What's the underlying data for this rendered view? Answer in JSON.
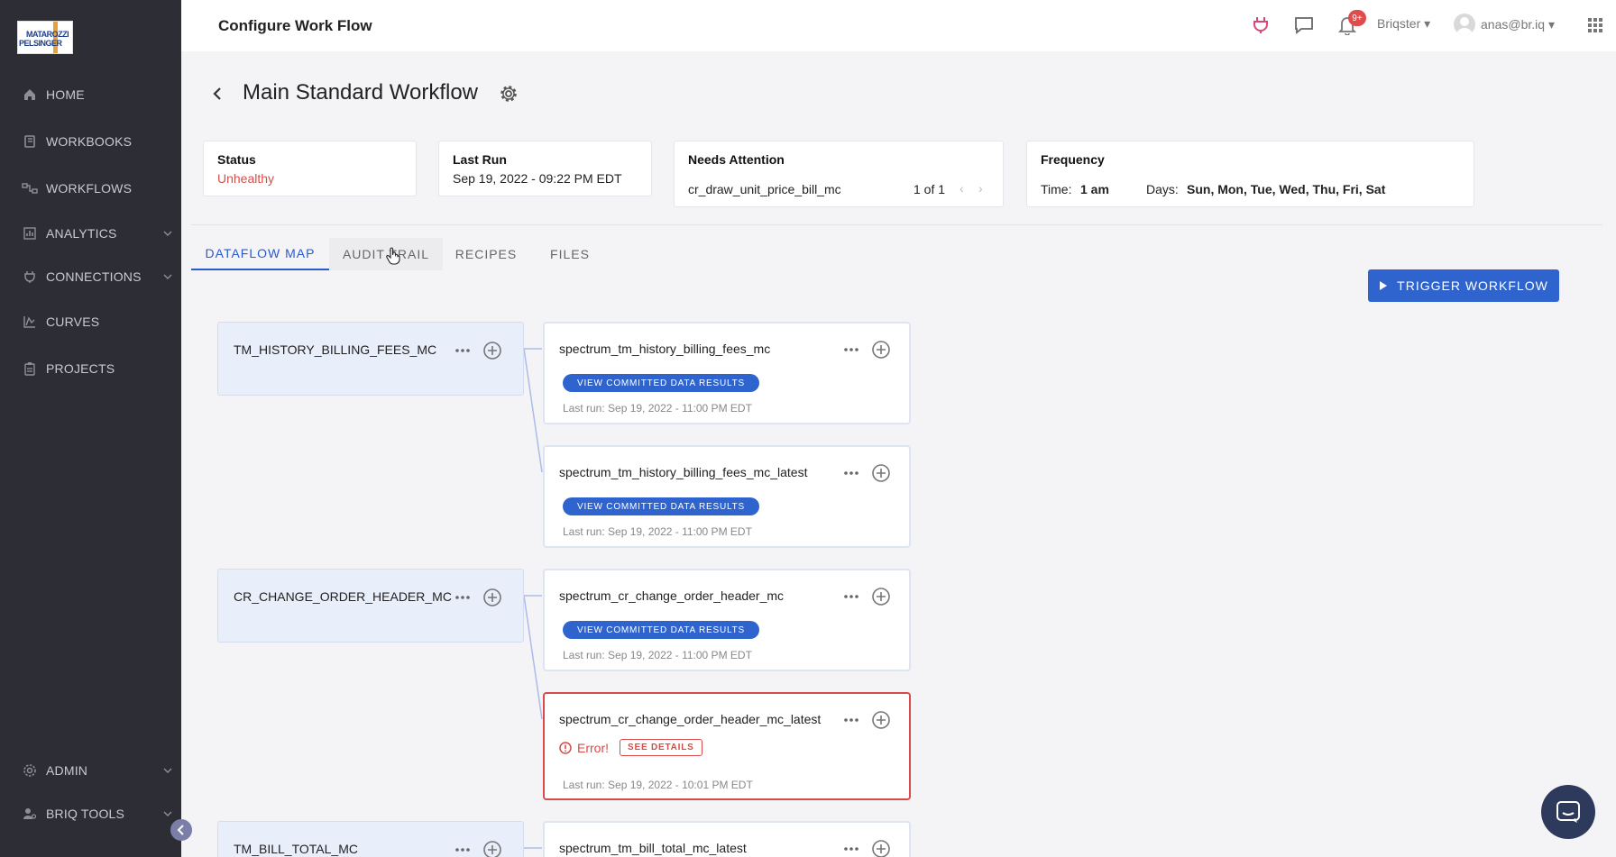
{
  "sidebar": {
    "logo_line1": "MATAROZZI",
    "logo_line2": "PELSINGER",
    "items": [
      {
        "label": "HOME",
        "icon": "home-icon"
      },
      {
        "label": "WORKBOOKS",
        "icon": "book-icon"
      },
      {
        "label": "WORKFLOWS",
        "icon": "workflow-icon"
      },
      {
        "label": "ANALYTICS",
        "icon": "chart-icon"
      },
      {
        "label": "CONNECTIONS",
        "icon": "plug-icon"
      },
      {
        "label": "CURVES",
        "icon": "curve-icon"
      },
      {
        "label": "PROJECTS",
        "icon": "clipboard-icon"
      },
      {
        "label": "ADMIN",
        "icon": "gear-icon"
      },
      {
        "label": "BRIQ TOOLS",
        "icon": "user-settings-icon"
      }
    ]
  },
  "header": {
    "title": "Configure Work Flow",
    "notification_count": "9+",
    "org": "Briqster",
    "user": "anas@br.iq"
  },
  "workflow": {
    "title": "Main Standard Workflow",
    "status_label": "Status",
    "status_value": "Unhealthy",
    "last_run_label": "Last Run",
    "last_run_value": "Sep 19, 2022 - 09:22 PM EDT",
    "attention_label": "Needs Attention",
    "attention_item": "cr_draw_unit_price_bill_mc",
    "attention_pager": "1 of 1",
    "frequency_label": "Frequency",
    "time_label": "Time:",
    "time_value": "1 am",
    "days_label": "Days:",
    "days_value": "Sun, Mon, Tue, Wed, Thu, Fri, Sat"
  },
  "tabs": [
    "DATAFLOW MAP",
    "AUDIT TRAIL",
    "RECIPES",
    "FILES"
  ],
  "trigger_label": "TRIGGER WORKFLOW",
  "dataflow": {
    "sources": [
      "TM_HISTORY_BILLING_FEES_MC",
      "CR_CHANGE_ORDER_HEADER_MC",
      "TM_BILL_TOTAL_MC"
    ],
    "nodes": [
      {
        "name": "spectrum_tm_history_billing_fees_mc",
        "button": "VIEW COMMITTED DATA RESULTS",
        "last_run": "Last run: Sep 19, 2022 - 11:00 PM EDT"
      },
      {
        "name": "spectrum_tm_history_billing_fees_mc_latest",
        "button": "VIEW COMMITTED DATA RESULTS",
        "last_run": "Last run: Sep 19, 2022 - 11:00 PM EDT"
      },
      {
        "name": "spectrum_cr_change_order_header_mc",
        "button": "VIEW COMMITTED DATA RESULTS",
        "last_run": "Last run: Sep 19, 2022 - 11:00 PM EDT"
      },
      {
        "name": "spectrum_cr_change_order_header_mc_latest",
        "error": "Error!",
        "details": "SEE DETAILS",
        "last_run": "Last run: Sep 19, 2022 - 10:01 PM EDT"
      },
      {
        "name": "spectrum_tm_bill_total_mc_latest"
      }
    ]
  },
  "colors": {
    "accent": "#2f64cf",
    "error": "#d94a4a",
    "sidebar": "#2d2e35"
  }
}
